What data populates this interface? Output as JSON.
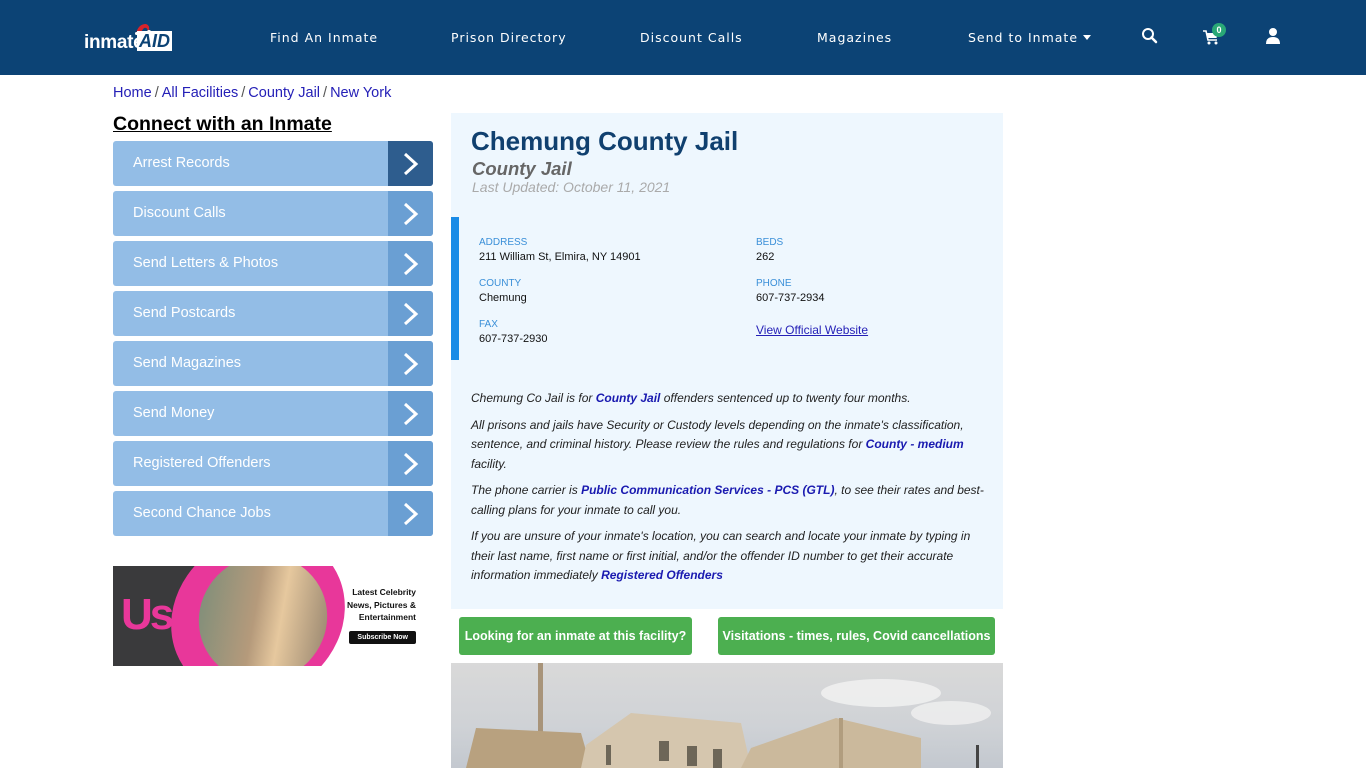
{
  "header": {
    "logo": {
      "part1": "inmate",
      "part2": "AID"
    },
    "nav": [
      {
        "label": "Find An Inmate"
      },
      {
        "label": "Prison Directory"
      },
      {
        "label": "Discount Calls"
      },
      {
        "label": "Magazines"
      },
      {
        "label": "Send to Inmate",
        "has_dropdown": true
      }
    ],
    "icons": [
      "search-icon",
      "cart-icon",
      "user-icon"
    ],
    "cart_count": "0",
    "colors": {
      "bar": "#0c4375",
      "badge": "#2aa876"
    }
  },
  "breadcrumb": [
    {
      "label": "Home"
    },
    {
      "label": "All Facilities"
    },
    {
      "label": "County Jail"
    },
    {
      "label": "New York"
    }
  ],
  "sidebar": {
    "title": "Connect with an Inmate",
    "items": [
      {
        "label": "Arrest Records",
        "active": true
      },
      {
        "label": "Discount Calls"
      },
      {
        "label": "Send Letters & Photos"
      },
      {
        "label": "Send Postcards"
      },
      {
        "label": "Send Magazines"
      },
      {
        "label": "Send Money"
      },
      {
        "label": "Registered Offenders"
      },
      {
        "label": "Second Chance Jobs"
      }
    ],
    "ad": {
      "brand": "Us",
      "text_lines": [
        "Latest Celebrity",
        "News, Pictures &",
        "Entertainment"
      ],
      "button": "Subscribe Now"
    }
  },
  "facility": {
    "name": "Chemung County Jail",
    "type": "County Jail",
    "last_updated": "Last Updated: October 11, 2021",
    "address": {
      "label": "ADDRESS",
      "value": "211 William St, Elmira, NY 14901"
    },
    "county": {
      "label": "COUNTY",
      "value": "Chemung"
    },
    "fax": {
      "label": "FAX",
      "value": "607-737-2930"
    },
    "beds": {
      "label": "BEDS",
      "value": "262"
    },
    "phone": {
      "label": "PHONE",
      "value": "607-737-2934"
    },
    "website_link": "View Official Website",
    "description": {
      "p1": {
        "pre": "Chemung Co Jail is for ",
        "link": "County Jail",
        "post": " offenders sentenced up to twenty four months."
      },
      "p2": {
        "pre": "All prisons and jails have Security or Custody levels depending on the inmate's classification, sentence, and criminal history. Please review the rules and regulations for ",
        "link": "County - medium",
        "post": " facility."
      },
      "p3": {
        "pre": "The phone carrier is ",
        "link": "Public Communication Services - PCS (GTL)",
        "post": ", to see their rates and best-calling plans for your inmate to call you."
      },
      "p4": {
        "pre": "If you are unsure of your inmate's location, you can search and locate your inmate by typing in their last name, first name or first initial, and/or the offender ID number to get their accurate information immediately ",
        "link": "Registered Offenders",
        "post": ""
      }
    }
  },
  "actions": {
    "find_inmate": "Looking for an inmate at this facility?",
    "visitations": "Visitations - times, rules, Covid cancellations"
  }
}
